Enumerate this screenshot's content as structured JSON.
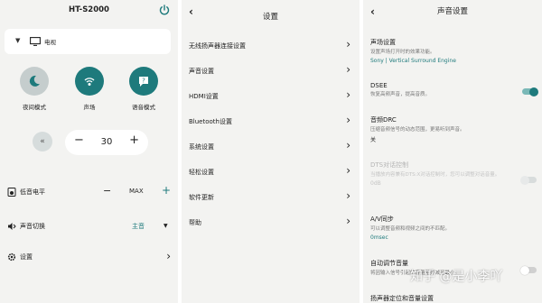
{
  "colors": {
    "accent": "#1e7a7c",
    "panel_bg": "#f3f3f1"
  },
  "remote": {
    "title": "HT-S2000",
    "device": "电视",
    "modes": [
      {
        "label": "夜间模式",
        "icon": "moon-icon",
        "active": false
      },
      {
        "label": "声场",
        "icon": "sound-field-icon",
        "active": true
      },
      {
        "label": "语音模式",
        "icon": "voice-icon",
        "active": true
      }
    ],
    "volume": {
      "value": "30",
      "minus": "−",
      "plus": "+"
    },
    "bass": {
      "label": "低音电平",
      "minus": "−",
      "value": "MAX",
      "plus": "+"
    },
    "sound_switch": {
      "label": "声音切换",
      "value": "主音"
    },
    "settings_label": "设置"
  },
  "settings": {
    "title": "设置",
    "items": [
      "无线扬声器连接设置",
      "声音设置",
      "HDMI设置",
      "Bluetooth设置",
      "系统设置",
      "轻松设置",
      "软件更新",
      "帮助"
    ]
  },
  "sound_settings": {
    "title": "声音设置",
    "items": [
      {
        "title": "声场设置",
        "desc": "设置声场打开时的效果功能。",
        "value": "Sony | Vertical Surround Engine"
      },
      {
        "title": "DSEE",
        "desc": "恢复高频声音，提高音质。",
        "toggle": "on"
      },
      {
        "title": "音频DRC",
        "desc": "压缩音频信号的动态范围，更易听到声音。",
        "value": "关"
      },
      {
        "title": "DTS对话控制",
        "desc": "当播放内容兼有DTS:X对话控制时，您可以调整对话音量。",
        "value": "0dB",
        "disabled": true,
        "toggle": "off"
      },
      {
        "title": "A/V同步",
        "desc": "可以调整音频和视频之间的不匹配。",
        "value": "0msec"
      },
      {
        "title": "自动调节音量",
        "desc": "将因输入信号引起的音量差异减至最小。",
        "toggle": "off"
      },
      {
        "title": "扬声器定位和音量设置"
      }
    ]
  },
  "watermark": "知乎 @是小李吖"
}
